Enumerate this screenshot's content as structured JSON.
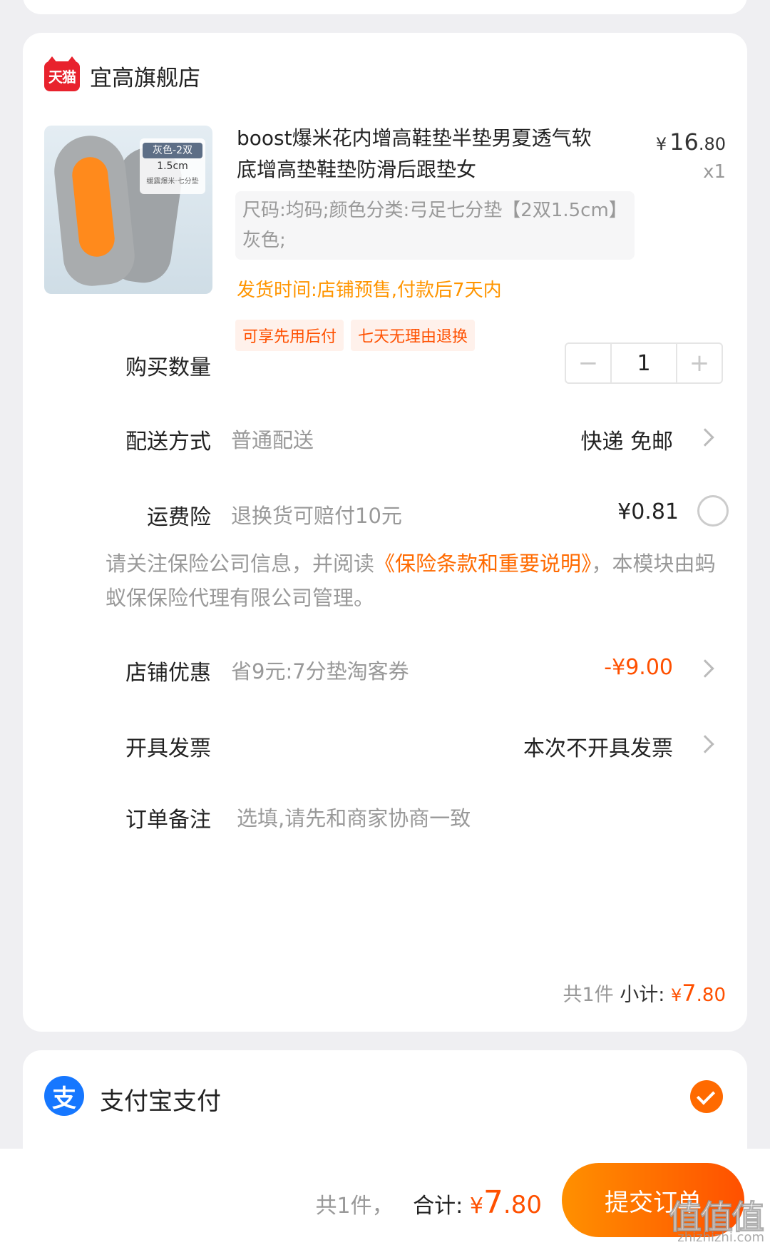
{
  "store": {
    "logo_text": "天猫",
    "name": "宜高旗舰店"
  },
  "product": {
    "image_tag": {
      "color": "灰色-2双",
      "height": "1.5cm",
      "desc": "缓震爆米·七分垫"
    },
    "title": "boost爆米花内增高鞋垫半垫男夏透气软底增高垫鞋垫防滑后跟垫女",
    "price_currency": "¥",
    "price_int": "16",
    "price_dec": ".80",
    "quantity": "x1",
    "sku": "尺码:均码;颜色分类:弓足七分垫【2双1.5cm】灰色;",
    "ship_time": "发货时间:店铺预售,付款后7天内",
    "badges": [
      "可享先用后付",
      "七天无理由退换"
    ]
  },
  "rows": {
    "quantity": {
      "label": "购买数量",
      "minus": "−",
      "value": "1",
      "plus": "+"
    },
    "delivery": {
      "label": "配送方式",
      "sub": "普通配送",
      "value": "快递 免邮"
    },
    "insurance": {
      "label": "运费险",
      "sub": "退换货可赔付10元",
      "value": "¥0.81"
    },
    "notice": {
      "pre": "请关注保险公司信息，并阅读",
      "link": "《保险条款和重要说明》",
      "post": "，本模块由蚂蚁保保险代理有限公司管理。"
    },
    "coupon": {
      "label": "店铺优惠",
      "sub": "省9元:7分垫淘客券",
      "value": "-¥9.00"
    },
    "invoice": {
      "label": "开具发票",
      "value": "本次不开具发票"
    },
    "remark": {
      "label": "订单备注",
      "placeholder": "选填,请先和商家协商一致"
    }
  },
  "subtotal": {
    "count": "共1件",
    "label": "小计:",
    "currency": "¥",
    "int": "7",
    "dec": ".80"
  },
  "payment": {
    "icon_char": "支",
    "name": "支付宝支付"
  },
  "footer": {
    "count": "共1件，",
    "label": "合计:",
    "currency": "¥",
    "int": "7",
    "dec": ".80",
    "submit_label": "提交订单"
  },
  "watermark": {
    "text": "值值值",
    "url": "zhizhizhi.com"
  },
  "colors": {
    "accent": "#ff5000",
    "ship_time": "#ff9500",
    "alipay": "#1677ff",
    "tmall": "#e8222d"
  }
}
